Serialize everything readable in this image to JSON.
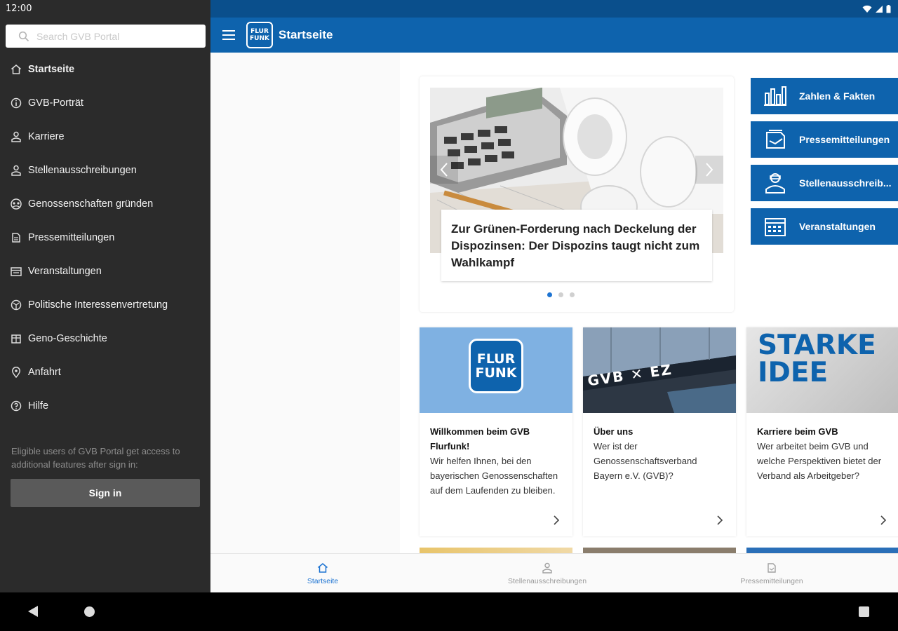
{
  "status": {
    "time": "12:00"
  },
  "drawer": {
    "search_placeholder": "Search GVB Portal",
    "items": [
      {
        "label": "Startseite",
        "icon": "home-icon",
        "active": true
      },
      {
        "label": "GVB-Porträt",
        "icon": "info-icon"
      },
      {
        "label": "Karriere",
        "icon": "person-icon"
      },
      {
        "label": "Stellenausschreibungen",
        "icon": "person-icon"
      },
      {
        "label": "Genossenschaften gründen",
        "icon": "group-icon"
      },
      {
        "label": "Pressemitteilungen",
        "icon": "document-icon"
      },
      {
        "label": "Veranstaltungen",
        "icon": "calendar-icon"
      },
      {
        "label": "Politische Interessenvertretung",
        "icon": "globe-icon"
      },
      {
        "label": "Geno-Geschichte",
        "icon": "book-icon"
      },
      {
        "label": "Anfahrt",
        "icon": "location-icon"
      },
      {
        "label": "Hilfe",
        "icon": "help-icon"
      }
    ],
    "note": "Eligible users of GVB Portal get access to additional features after sign in:",
    "signin_label": "Sign in"
  },
  "appbar": {
    "title": "Startseite",
    "logo_top": "FLUR",
    "logo_bottom": "FUNK"
  },
  "hero": {
    "caption": "Zur Grünen-Forderung nach Deckelung der Dispozinsen: Der Dispozins taugt nicht zum Wahlkampf",
    "dots": 3,
    "active_dot": 0
  },
  "quick_links": [
    {
      "label": "Zahlen & Fakten",
      "icon": "chart-icon"
    },
    {
      "label": "Pressemitteilungen",
      "icon": "document-icon"
    },
    {
      "label": "Stellenausschreib...",
      "icon": "person-icon"
    },
    {
      "label": "Veranstaltungen",
      "icon": "calendar-icon"
    }
  ],
  "cards": [
    {
      "title": "Willkommen beim GVB Flurfunk!",
      "text": "Wir helfen Ihnen, bei den bayerischen Genossenschaften auf dem Laufenden zu bleiben.",
      "logo_top": "FLUR",
      "logo_bottom": "FUNK"
    },
    {
      "title": "Über uns",
      "text": "Wer ist der Genossenschaftsverband Bayern e.V. (GVB)?",
      "sign": "GVB ✕ EZ"
    },
    {
      "title": "Karriere beim GVB",
      "text": "Wer arbeitet beim GVB und welche Perspektiven bietet der Verband als Arbeitgeber?",
      "banner_1": "STARKE",
      "banner_2": "IDEE"
    }
  ],
  "bottom_nav": [
    {
      "label": "Startseite",
      "icon": "home-icon",
      "active": true
    },
    {
      "label": "Stellenausschreibungen",
      "icon": "person-icon"
    },
    {
      "label": "Pressemitteilungen",
      "icon": "document-icon"
    }
  ],
  "colors": {
    "primary": "#0e63ad",
    "statusbar": "#0a4f8c",
    "drawer": "#2b2b2b",
    "accent": "#1e74d2"
  }
}
